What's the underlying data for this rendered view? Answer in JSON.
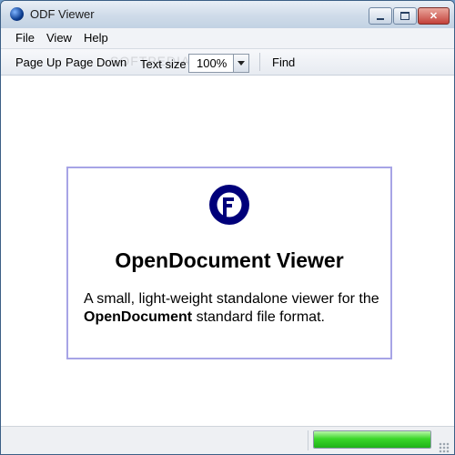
{
  "window": {
    "title": "ODF Viewer"
  },
  "menu": {
    "file": "File",
    "view": "View",
    "help": "Help"
  },
  "toolbar": {
    "page_up": "Page Up",
    "page_down": "Page Down",
    "text_size_label": "Text size",
    "text_size_value": "100%",
    "find": "Find",
    "watermark": "SOFTPEDIA",
    "watermark_url": "www.softpedia.com"
  },
  "document": {
    "title": "OpenDocument Viewer",
    "desc_pre": "A small, light-weight standalone viewer for the ",
    "desc_bold": "OpenDocument",
    "desc_post": " standard file format.",
    "logo_icon": "opendocument-logo",
    "accent_color": "#00007a",
    "border_color": "#a7a4e6"
  },
  "status": {
    "progress_fraction": 1.0,
    "progress_color": "#3bd72a"
  }
}
